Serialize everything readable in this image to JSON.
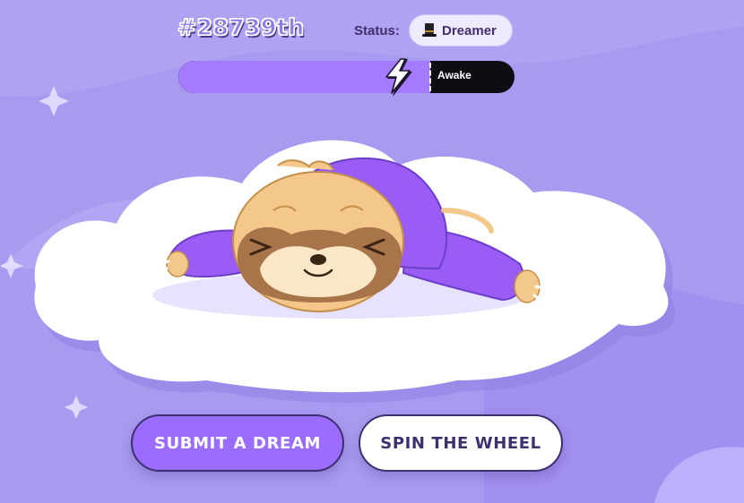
{
  "header": {
    "rank": "#28739th",
    "status_label": "Status:",
    "status_value": "Dreamer",
    "status_icon": "top-hat-icon"
  },
  "energy": {
    "label": "Awake",
    "level": 0.75
  },
  "actions": {
    "submit_label": "SUBMIT A DREAM",
    "spin_label": "SPIN THE WHEEL"
  },
  "colors": {
    "background": "#a99af1",
    "accent": "#9a6cff",
    "dark": "#3e2f6e"
  }
}
